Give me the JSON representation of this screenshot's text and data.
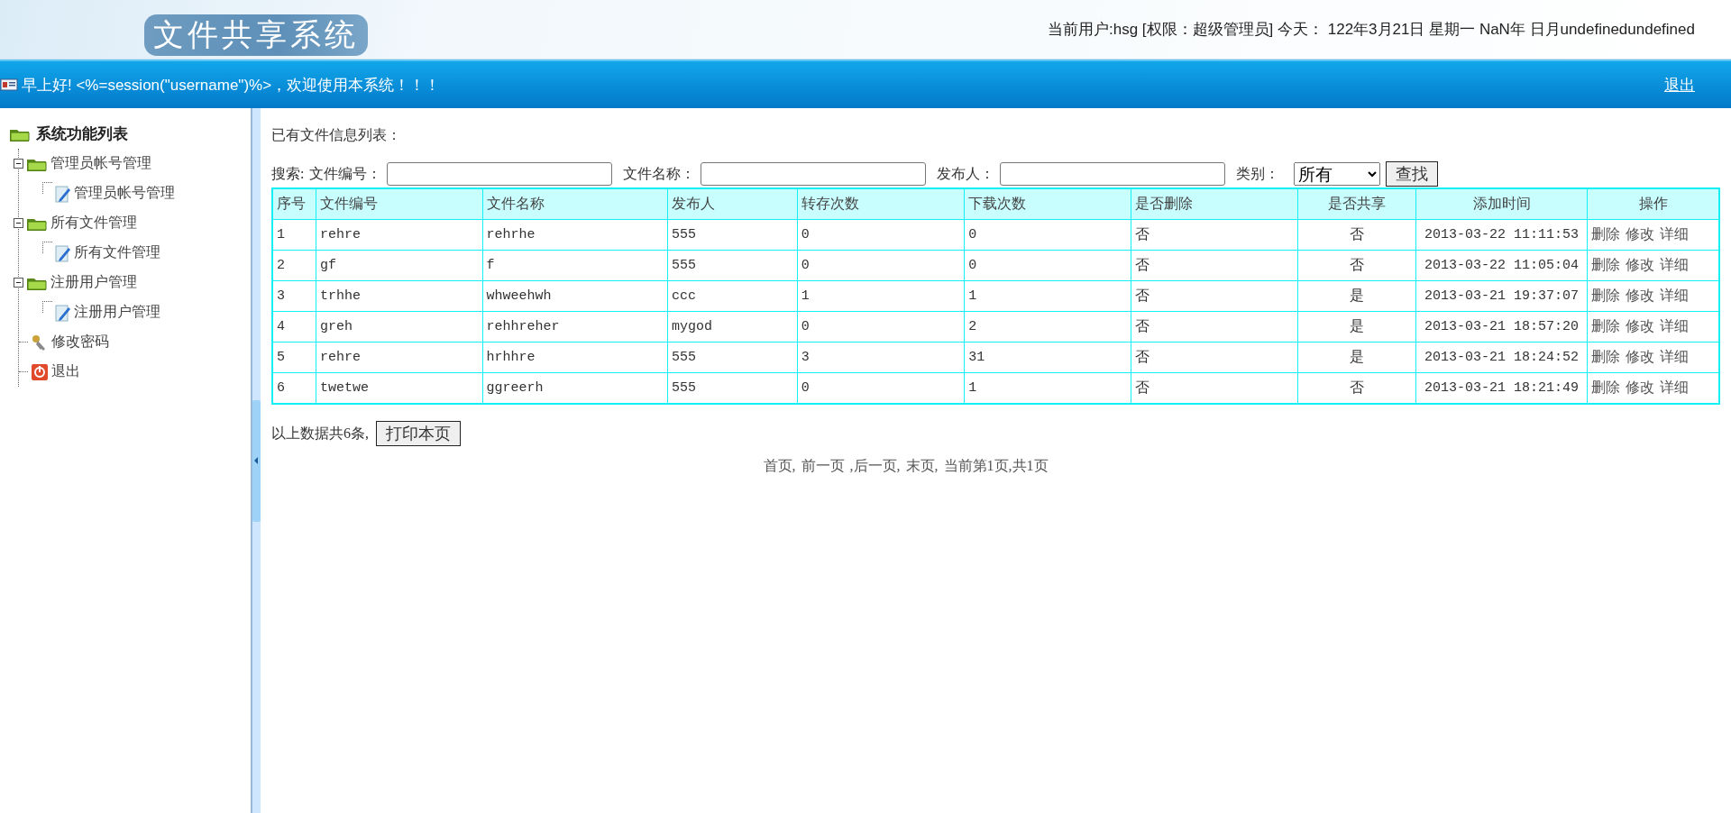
{
  "header": {
    "logo": "文件共享系统",
    "user_info": "当前用户:hsg [权限：超级管理员] 今天： 122年3月21日 星期一 NaN年 日月undefinedundefined"
  },
  "nav_bar": {
    "greeting": "早上好! <%=session(\"username\")%>，欢迎使用本系统！！！",
    "logout": "退出"
  },
  "sidebar": {
    "title": "系统功能列表",
    "items": [
      {
        "kind": "folder",
        "label": "管理员帐号管理",
        "expanded": true,
        "children": [
          {
            "kind": "page",
            "label": "管理员帐号管理"
          }
        ]
      },
      {
        "kind": "folder",
        "label": "所有文件管理",
        "expanded": true,
        "children": [
          {
            "kind": "page",
            "label": "所有文件管理"
          }
        ]
      },
      {
        "kind": "folder",
        "label": "注册用户管理",
        "expanded": true,
        "children": [
          {
            "kind": "page",
            "label": "注册用户管理"
          }
        ]
      },
      {
        "kind": "key",
        "label": "修改密码"
      },
      {
        "kind": "exit",
        "label": "退出"
      }
    ]
  },
  "content": {
    "heading": "已有文件信息列表：",
    "search": {
      "label": "搜索:",
      "fields": [
        {
          "label": "文件编号："
        },
        {
          "label": "文件名称："
        },
        {
          "label": "发布人："
        }
      ],
      "category_label": "类别：",
      "category_value": "所有",
      "button": "查找"
    },
    "table": {
      "columns": [
        "序号",
        "文件编号",
        "文件名称",
        "发布人",
        "转存次数",
        "下载次数",
        "是否删除",
        "是否共享",
        "添加时间",
        "操作"
      ],
      "rows": [
        {
          "cells": [
            "1",
            "rehre",
            "rehrhe",
            "555",
            "0",
            "0",
            "否",
            "否",
            "2013-03-22 11:11:53"
          ],
          "actions": [
            "删除",
            "修改",
            "详细"
          ]
        },
        {
          "cells": [
            "2",
            "gf",
            "f",
            "555",
            "0",
            "0",
            "否",
            "否",
            "2013-03-22 11:05:04"
          ],
          "actions": [
            "删除",
            "修改",
            "详细"
          ]
        },
        {
          "cells": [
            "3",
            "trhhe",
            "whweehwh",
            "ccc",
            "1",
            "1",
            "否",
            "是",
            "2013-03-21 19:37:07"
          ],
          "actions": [
            "删除",
            "修改",
            "详细"
          ]
        },
        {
          "cells": [
            "4",
            "greh",
            "rehhreher",
            "mygod",
            "0",
            "2",
            "否",
            "是",
            "2013-03-21 18:57:20"
          ],
          "actions": [
            "删除",
            "修改",
            "详细"
          ]
        },
        {
          "cells": [
            "5",
            "rehre",
            "hrhhre",
            "555",
            "3",
            "31",
            "否",
            "是",
            "2013-03-21 18:24:52"
          ],
          "actions": [
            "删除",
            "修改",
            "详细"
          ]
        },
        {
          "cells": [
            "6",
            "twetwe",
            "ggreerh",
            "555",
            "0",
            "1",
            "否",
            "否",
            "2013-03-21 18:21:49"
          ],
          "actions": [
            "删除",
            "修改",
            "详细"
          ]
        }
      ]
    },
    "summary": "以上数据共6条,",
    "print_button": "打印本页",
    "pager": [
      "首页,",
      "前一页",
      ",后一页,",
      "末页,",
      "当前第1页,共1页"
    ]
  }
}
